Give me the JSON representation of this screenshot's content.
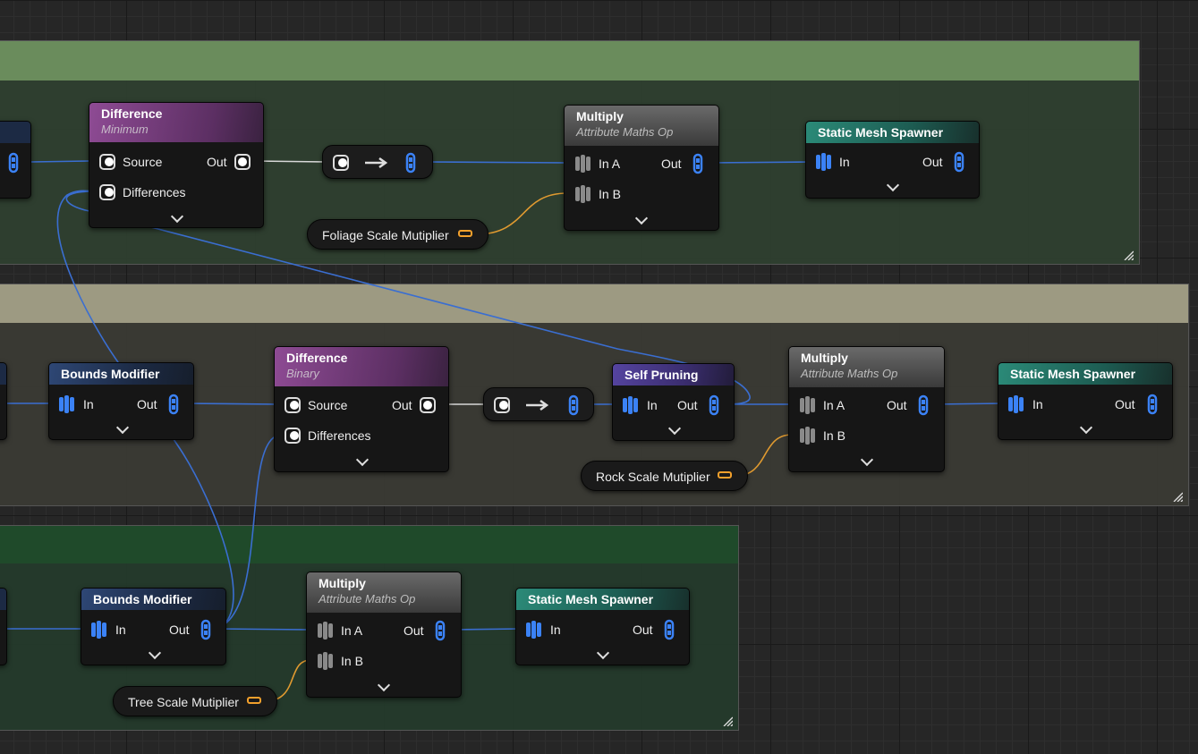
{
  "colors": {
    "group_green": "#6a8c5c",
    "group_beige": "#9d9a82",
    "group_dark_green": "#1f4a2a",
    "spatial_header": "#5c2f63",
    "attribute_header": "#5a5a5a",
    "spawner_header": "#1d5c52",
    "bounds_header": "#1c2a44",
    "pruning_header": "#3a2d6e",
    "pin_blue": "#3b82f6",
    "pin_orange": "#f2a02c",
    "wire_blue": "#3a6ed1"
  },
  "groups": {
    "foliage": {
      "label": ""
    },
    "rocks": {
      "label": ""
    },
    "trees": {
      "label": ""
    }
  },
  "nodes": {
    "diff_min": {
      "title": "Difference",
      "subtitle": "Minimum",
      "pin_source": "Source",
      "pin_out": "Out",
      "pin_differences": "Differences"
    },
    "multiply_foliage": {
      "title": "Multiply",
      "subtitle": "Attribute Maths Op",
      "pin_in_a": "In A",
      "pin_in_b": "In B",
      "pin_out": "Out"
    },
    "spawner_foliage": {
      "title": "Static Mesh Spawner",
      "pin_in": "In",
      "pin_out": "Out"
    },
    "bounds_rocks": {
      "title": "Bounds Modifier",
      "pin_in": "In",
      "pin_out": "Out"
    },
    "diff_binary": {
      "title": "Difference",
      "subtitle": "Binary",
      "pin_source": "Source",
      "pin_out": "Out",
      "pin_differences": "Differences"
    },
    "self_pruning": {
      "title": "Self Pruning",
      "pin_in": "In",
      "pin_out": "Out"
    },
    "multiply_rocks": {
      "title": "Multiply",
      "subtitle": "Attribute Maths Op",
      "pin_in_a": "In A",
      "pin_in_b": "In B",
      "pin_out": "Out"
    },
    "spawner_rocks": {
      "title": "Static Mesh Spawner",
      "pin_in": "In",
      "pin_out": "Out"
    },
    "bounds_trees": {
      "title": "Bounds Modifier",
      "pin_in": "In",
      "pin_out": "Out"
    },
    "multiply_trees": {
      "title": "Multiply",
      "subtitle": "Attribute Maths Op",
      "pin_in_a": "In A",
      "pin_in_b": "In B",
      "pin_out": "Out"
    },
    "spawner_trees": {
      "title": "Static Mesh Spawner",
      "pin_in": "In",
      "pin_out": "Out"
    }
  },
  "params": {
    "foliage": "Foliage Scale Mutiplier",
    "rock": "Rock Scale Mutiplier",
    "tree": "Tree Scale Mutiplier"
  },
  "icons": {
    "spatial_pin": "spatial-data-pin-icon",
    "point_pin": "point-data-pin-icon",
    "attribute_pin": "attribute-pin-icon",
    "convert_arrow": "arrow-right-icon",
    "expand": "chevron-down-icon",
    "resize": "resize-grip-icon",
    "param_type": "float-param-icon"
  }
}
